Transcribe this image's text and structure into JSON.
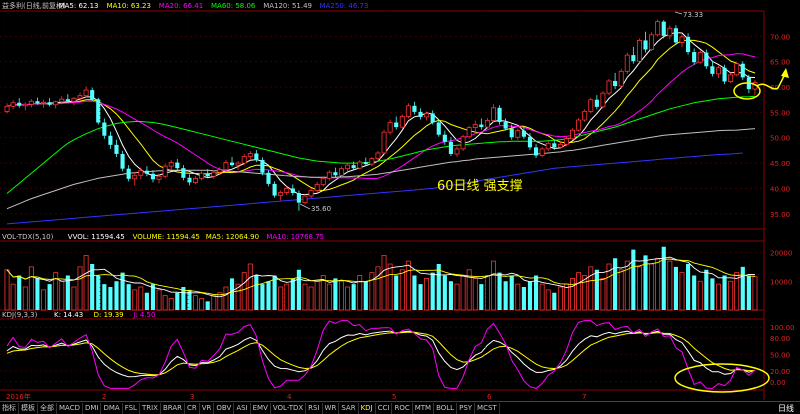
{
  "chart_data": {
    "type": "candlestick",
    "header_main": {
      "name": "益多利(日线,前复权)",
      "items": [
        {
          "label": "MA5: 62.13",
          "color": "#ffffff"
        },
        {
          "label": "MA10: 63.23",
          "color": "#ffff00"
        },
        {
          "label": "MA20: 66.41",
          "color": "#ff00ff"
        },
        {
          "label": "MA60: 58.06",
          "color": "#00ff00"
        },
        {
          "label": "MA120: 51.49",
          "color": "#c0c0c0"
        },
        {
          "label": "MA250: 46.73",
          "color": "#3333ff"
        }
      ]
    },
    "price_axis": {
      "ticks": [
        70,
        65,
        60,
        55,
        50,
        45,
        40,
        35
      ],
      "min": 32,
      "max": 75
    },
    "annotations": {
      "high": "73.33",
      "low": "35.60",
      "note": "60日线 强支撑"
    },
    "candles": [
      [
        55.2,
        56.8,
        54.8,
        56.2
      ],
      [
        56.2,
        57.4,
        55.6,
        56.9
      ],
      [
        56.9,
        57.8,
        55.9,
        56.3
      ],
      [
        56.3,
        57.0,
        55.4,
        56.6
      ],
      [
        56.6,
        57.6,
        56.0,
        57.2
      ],
      [
        57.2,
        57.9,
        56.5,
        56.8
      ],
      [
        56.8,
        57.5,
        55.9,
        57.0
      ],
      [
        57.0,
        57.8,
        56.2,
        56.5
      ],
      [
        56.5,
        57.3,
        55.8,
        57.1
      ],
      [
        57.1,
        58.2,
        56.6,
        57.6
      ],
      [
        57.6,
        58.6,
        56.9,
        57.2
      ],
      [
        57.2,
        58.0,
        56.4,
        57.8
      ],
      [
        57.8,
        58.9,
        57.2,
        58.3
      ],
      [
        58.3,
        60.1,
        57.9,
        59.4
      ],
      [
        59.4,
        59.9,
        57.2,
        57.6
      ],
      [
        57.6,
        57.9,
        52.6,
        53.0
      ],
      [
        53.0,
        53.8,
        49.8,
        50.4
      ],
      [
        50.4,
        51.2,
        47.8,
        48.6
      ],
      [
        48.6,
        49.6,
        46.2,
        46.8
      ],
      [
        46.8,
        47.4,
        43.4,
        43.9
      ],
      [
        43.9,
        44.6,
        41.4,
        41.9
      ],
      [
        41.9,
        43.2,
        40.6,
        42.6
      ],
      [
        42.6,
        44.1,
        41.8,
        43.5
      ],
      [
        43.5,
        44.4,
        42.4,
        42.9
      ],
      [
        42.9,
        43.6,
        41.2,
        41.8
      ],
      [
        41.8,
        42.9,
        41.0,
        42.4
      ],
      [
        42.4,
        44.9,
        42.0,
        44.4
      ],
      [
        44.4,
        45.6,
        43.6,
        45.1
      ],
      [
        45.1,
        45.8,
        43.6,
        44.0
      ],
      [
        44.0,
        44.6,
        41.6,
        42.1
      ],
      [
        42.1,
        42.8,
        40.6,
        41.2
      ],
      [
        41.2,
        42.4,
        40.8,
        42.0
      ],
      [
        42.0,
        43.4,
        41.6,
        43.0
      ],
      [
        43.0,
        43.8,
        42.0,
        42.4
      ],
      [
        42.4,
        43.6,
        41.9,
        43.2
      ],
      [
        43.2,
        44.2,
        42.6,
        43.7
      ],
      [
        43.7,
        45.6,
        43.3,
        45.1
      ],
      [
        45.1,
        46.2,
        44.3,
        44.6
      ],
      [
        44.6,
        45.4,
        43.6,
        45.0
      ],
      [
        45.0,
        46.8,
        44.6,
        46.3
      ],
      [
        46.3,
        47.4,
        45.6,
        46.9
      ],
      [
        46.9,
        47.6,
        45.2,
        45.6
      ],
      [
        45.6,
        46.1,
        42.6,
        43.1
      ],
      [
        43.1,
        43.6,
        40.4,
        40.9
      ],
      [
        40.9,
        41.4,
        38.2,
        38.6
      ],
      [
        38.6,
        39.6,
        37.6,
        39.2
      ],
      [
        39.2,
        40.4,
        38.7,
        40.0
      ],
      [
        40.0,
        40.8,
        38.6,
        39.1
      ],
      [
        39.1,
        39.6,
        35.6,
        37.2
      ],
      [
        37.2,
        38.9,
        36.8,
        38.5
      ],
      [
        38.5,
        40.1,
        38.1,
        39.6
      ],
      [
        39.6,
        41.3,
        39.1,
        40.8
      ],
      [
        40.8,
        42.4,
        40.4,
        42.0
      ],
      [
        42.0,
        43.6,
        41.5,
        43.2
      ],
      [
        43.2,
        44.1,
        42.1,
        42.6
      ],
      [
        42.6,
        44.3,
        42.2,
        43.9
      ],
      [
        43.9,
        45.1,
        43.4,
        44.6
      ],
      [
        44.6,
        45.3,
        43.6,
        44.0
      ],
      [
        44.0,
        45.6,
        43.8,
        45.2
      ],
      [
        45.2,
        46.1,
        44.4,
        44.8
      ],
      [
        44.8,
        46.2,
        44.4,
        45.9
      ],
      [
        45.9,
        47.4,
        45.6,
        47.0
      ],
      [
        47.0,
        51.6,
        46.8,
        51.1
      ],
      [
        51.1,
        53.6,
        50.6,
        53.0
      ],
      [
        53.0,
        54.2,
        51.6,
        52.1
      ],
      [
        52.1,
        54.6,
        51.8,
        54.2
      ],
      [
        54.2,
        56.8,
        53.8,
        56.3
      ],
      [
        56.3,
        57.1,
        54.6,
        55.1
      ],
      [
        55.1,
        55.8,
        53.6,
        54.1
      ],
      [
        54.1,
        55.2,
        53.4,
        54.8
      ],
      [
        54.8,
        55.4,
        52.6,
        53.0
      ],
      [
        53.0,
        53.6,
        50.2,
        50.6
      ],
      [
        50.6,
        51.4,
        48.6,
        49.2
      ],
      [
        49.2,
        50.1,
        46.4,
        46.8
      ],
      [
        46.8,
        48.3,
        46.2,
        47.8
      ],
      [
        47.8,
        50.6,
        47.4,
        50.2
      ],
      [
        50.2,
        52.4,
        49.8,
        52.0
      ],
      [
        52.0,
        53.4,
        51.1,
        52.6
      ],
      [
        52.6,
        53.8,
        51.6,
        52.1
      ],
      [
        52.1,
        53.9,
        51.8,
        53.4
      ],
      [
        53.4,
        56.6,
        53.1,
        55.9
      ],
      [
        55.9,
        56.4,
        52.6,
        53.1
      ],
      [
        53.1,
        53.8,
        51.4,
        51.8
      ],
      [
        51.8,
        52.6,
        49.6,
        50.1
      ],
      [
        50.1,
        51.8,
        49.6,
        51.4
      ],
      [
        51.4,
        52.2,
        49.8,
        50.2
      ],
      [
        50.2,
        50.9,
        47.6,
        48.1
      ],
      [
        48.1,
        48.8,
        46.0,
        46.5
      ],
      [
        46.5,
        48.2,
        46.2,
        47.8
      ],
      [
        47.8,
        49.4,
        47.4,
        48.9
      ],
      [
        48.9,
        49.6,
        47.6,
        48.1
      ],
      [
        48.1,
        49.2,
        47.8,
        48.7
      ],
      [
        48.7,
        50.2,
        48.3,
        49.8
      ],
      [
        49.8,
        51.9,
        49.6,
        51.5
      ],
      [
        51.5,
        53.9,
        51.2,
        53.5
      ],
      [
        53.5,
        55.6,
        53.1,
        55.2
      ],
      [
        55.2,
        57.9,
        54.8,
        57.5
      ],
      [
        57.5,
        58.4,
        55.6,
        56.1
      ],
      [
        56.1,
        59.2,
        55.8,
        58.8
      ],
      [
        58.8,
        61.6,
        58.4,
        61.2
      ],
      [
        61.2,
        62.8,
        59.6,
        60.2
      ],
      [
        60.2,
        63.6,
        59.8,
        63.1
      ],
      [
        63.1,
        66.8,
        62.6,
        66.3
      ],
      [
        66.3,
        67.9,
        64.6,
        65.1
      ],
      [
        65.1,
        69.6,
        64.8,
        69.2
      ],
      [
        69.2,
        70.9,
        66.8,
        67.4
      ],
      [
        67.4,
        70.8,
        67.1,
        70.3
      ],
      [
        70.3,
        73.33,
        70.0,
        72.9
      ],
      [
        72.9,
        73.2,
        69.6,
        70.1
      ],
      [
        70.1,
        72.1,
        69.4,
        71.6
      ],
      [
        71.6,
        72.2,
        68.3,
        68.8
      ],
      [
        68.8,
        70.4,
        67.9,
        69.9
      ],
      [
        69.9,
        70.6,
        66.4,
        66.9
      ],
      [
        66.9,
        67.6,
        64.4,
        64.9
      ],
      [
        64.9,
        67.2,
        64.6,
        66.8
      ],
      [
        66.8,
        67.4,
        63.6,
        64.1
      ],
      [
        64.1,
        65.2,
        62.1,
        62.6
      ],
      [
        62.6,
        64.2,
        61.8,
        63.8
      ],
      [
        63.8,
        64.4,
        60.6,
        61.1
      ],
      [
        61.1,
        62.8,
        60.8,
        62.4
      ],
      [
        62.4,
        64.9,
        62.1,
        64.6
      ],
      [
        64.6,
        65.1,
        61.4,
        61.9
      ],
      [
        61.9,
        62.4,
        58.8,
        59.6
      ],
      [
        59.6,
        61.4,
        58.4,
        60.9
      ]
    ],
    "ma_lines": [
      {
        "name": "MA5",
        "color": "#ffffff",
        "period": 5
      },
      {
        "name": "MA10",
        "color": "#ffff00",
        "period": 10
      },
      {
        "name": "MA20",
        "color": "#ff00ff",
        "period": 20
      },
      {
        "name": "MA60",
        "color": "#00ff00",
        "values": [
          39,
          40,
          41,
          42,
          43,
          44,
          45,
          46,
          47,
          48,
          48.9,
          49.6,
          50.2,
          50.8,
          51.3,
          51.8,
          52.2,
          52.5,
          52.8,
          53,
          53.1,
          53.2,
          53.2,
          53.1,
          53,
          52.8,
          52.6,
          52.3,
          52,
          51.7,
          51.4,
          51.1,
          50.8,
          50.5,
          50.2,
          49.9,
          49.6,
          49.3,
          49,
          48.7,
          48.4,
          48.1,
          47.8,
          47.5,
          47.2,
          46.9,
          46.6,
          46.3,
          46,
          45.8,
          45.6,
          45.4,
          45.3,
          45.2,
          45.1,
          45,
          45,
          45,
          45,
          45.1,
          45.2,
          45.4,
          45.6,
          45.8,
          46.1,
          46.4,
          46.7,
          47,
          47.3,
          47.6,
          47.8,
          48,
          48.2,
          48.4,
          48.5,
          48.6,
          48.7,
          48.8,
          48.9,
          49,
          49.1,
          49.2,
          49.2,
          49.3,
          49.3,
          49.3,
          49.3,
          49.3,
          49.3,
          49.4,
          49.5,
          49.6,
          49.8,
          50,
          50.3,
          50.6,
          50.9,
          51.2,
          51.5,
          51.8,
          52.1,
          52.5,
          52.9,
          53.3,
          53.7,
          54.1,
          54.5,
          54.9,
          55.3,
          55.7,
          56,
          56.3,
          56.6,
          56.9,
          57.1,
          57.3,
          57.5,
          57.7,
          57.8,
          57.9,
          58,
          58.06,
          58.1,
          58.2,
          58.3
        ]
      },
      {
        "name": "MA120",
        "color": "#c0c0c0",
        "values": [
          36,
          36.5,
          37,
          37.5,
          38,
          38.4,
          38.8,
          39.2,
          39.6,
          40,
          40.4,
          40.8,
          41.1,
          41.4,
          41.7,
          42,
          42.2,
          42.4,
          42.6,
          42.8,
          43,
          43.1,
          43.2,
          43.3,
          43.4,
          43.5,
          43.5,
          43.6,
          43.6,
          43.6,
          43.6,
          43.6,
          43.6,
          43.6,
          43.5,
          43.5,
          43.4,
          43.4,
          43.3,
          43.2,
          43.1,
          43,
          42.9,
          42.8,
          42.7,
          42.6,
          42.5,
          42.4,
          42.3,
          42.3,
          42.2,
          42.2,
          42.2,
          42.2,
          42.2,
          42.3,
          42.3,
          42.4,
          42.5,
          42.6,
          42.7,
          42.8,
          43,
          43.2,
          43.4,
          43.6,
          43.8,
          44,
          44.2,
          44.4,
          44.6,
          44.8,
          45,
          45.2,
          45.3,
          45.5,
          45.6,
          45.8,
          45.9,
          46,
          46.1,
          46.2,
          46.3,
          46.4,
          46.5,
          46.6,
          46.7,
          46.8,
          46.9,
          47,
          47.1,
          47.2,
          47.4,
          47.5,
          47.7,
          47.9,
          48.1,
          48.3,
          48.5,
          48.7,
          48.9,
          49.1,
          49.3,
          49.5,
          49.7,
          49.9,
          50.1,
          50.3,
          50.5,
          50.6,
          50.7,
          50.8,
          50.9,
          51,
          51.1,
          51.2,
          51.3,
          51.4,
          51.45,
          51.49,
          51.5,
          51.6,
          51.7,
          51.8,
          51.9
        ]
      },
      {
        "name": "MA250",
        "color": "#3333ff",
        "values": [
          33,
          33.1,
          33.2,
          33.3,
          33.4,
          33.5,
          33.6,
          33.7,
          33.8,
          33.9,
          34,
          34.1,
          34.2,
          34.3,
          34.4,
          34.5,
          34.6,
          34.7,
          34.8,
          34.9,
          35,
          35.1,
          35.2,
          35.3,
          35.4,
          35.5,
          35.6,
          35.7,
          35.8,
          35.9,
          36,
          36.1,
          36.2,
          36.3,
          36.4,
          36.5,
          36.6,
          36.7,
          36.8,
          36.9,
          37,
          37.1,
          37.2,
          37.3,
          37.4,
          37.5,
          37.6,
          37.7,
          37.8,
          37.9,
          38,
          38.1,
          38.2,
          38.3,
          38.4,
          38.5,
          38.6,
          38.7,
          38.8,
          38.9,
          39,
          39.1,
          39.2,
          39.3,
          39.4,
          39.5,
          39.6,
          39.7,
          39.8,
          39.9,
          40,
          40.2,
          40.4,
          40.6,
          40.8,
          41,
          41.2,
          41.4,
          41.6,
          41.8,
          42,
          42.2,
          42.4,
          42.6,
          42.8,
          43,
          43.2,
          43.4,
          43.6,
          43.8,
          44,
          44.1,
          44.2,
          44.3,
          44.4,
          44.5,
          44.6,
          44.7,
          44.8,
          44.9,
          45,
          45.1,
          45.2,
          45.3,
          45.4,
          45.5,
          45.6,
          45.7,
          45.8,
          45.9,
          46,
          46.1,
          46.2,
          46.3,
          46.4,
          46.5,
          46.6,
          46.7,
          46.73,
          46.8,
          46.9,
          47
        ]
      }
    ],
    "volume": {
      "header_name": "VOL-TDX(5,10)",
      "items": [
        {
          "label": "VVOL: 11594.45",
          "color": "#ffffff"
        },
        {
          "label": "VOLUME: 11594.45",
          "color": "#ffff00"
        },
        {
          "label": "MA5: 12064.90",
          "color": "#ffff00"
        },
        {
          "label": "MA10: 10768.75",
          "color": "#ff00ff"
        }
      ],
      "ticks": [
        20000,
        10000
      ],
      "max": 24000,
      "values": [
        14000,
        9000,
        12000,
        8000,
        15000,
        11000,
        7000,
        9000,
        13000,
        10000,
        12000,
        8000,
        15000,
        19000,
        16000,
        12000,
        9000,
        8000,
        10000,
        13000,
        9000,
        7000,
        8000,
        6000,
        9000,
        7000,
        5000,
        4000,
        6000,
        8000,
        7000,
        5000,
        4000,
        3000,
        5000,
        6000,
        8000,
        11000,
        9000,
        13000,
        16000,
        12000,
        9000,
        10000,
        12000,
        8000,
        9000,
        11000,
        14000,
        9000,
        8000,
        10000,
        12000,
        9000,
        11000,
        10000,
        8000,
        9000,
        12000,
        10000,
        13000,
        15000,
        19000,
        16000,
        12000,
        14000,
        17000,
        12000,
        9000,
        11000,
        13000,
        16000,
        12000,
        10000,
        9000,
        12000,
        14000,
        11000,
        9000,
        12000,
        17000,
        13000,
        10000,
        12000,
        9000,
        8000,
        10000,
        12000,
        9000,
        7000,
        6000,
        8000,
        9000,
        11000,
        13000,
        12000,
        15000,
        14000,
        11000,
        16000,
        18000,
        14000,
        17000,
        21000,
        15000,
        19000,
        16000,
        18000,
        22000,
        17000,
        15000,
        13000,
        16000,
        12000,
        10000,
        14000,
        11000,
        9000,
        12000,
        10000,
        13000,
        15000,
        12000,
        11594
      ]
    },
    "kdj": {
      "header_name": "KDJ(9,3,3)",
      "items": [
        {
          "label": "K: 14.43",
          "color": "#ffffff"
        },
        {
          "label": "D: 19.39",
          "color": "#ffff00"
        },
        {
          "label": "J: 4.50",
          "color": "#ff00ff"
        }
      ],
      "ticks": [
        100,
        80,
        50,
        20,
        0
      ],
      "min": -15,
      "max": 115
    },
    "x_axis": {
      "labels": [
        "2016年",
        "2",
        "3",
        "4",
        "5",
        "6",
        "7"
      ]
    },
    "tabs": [
      "指标",
      "模板",
      "全部",
      "MACD",
      "DMI",
      "DMA",
      "FSL",
      "TRIX",
      "BRAR",
      "CR",
      "VR",
      "OBV",
      "ASI",
      "EMV",
      "VOL-TDX",
      "RSI",
      "WR",
      "SAR",
      "KDJ",
      "CCI",
      "ROC",
      "MTM",
      "BOLL",
      "PSY",
      "MCST"
    ],
    "active_tab": "KDJ",
    "period_label": "日线"
  }
}
